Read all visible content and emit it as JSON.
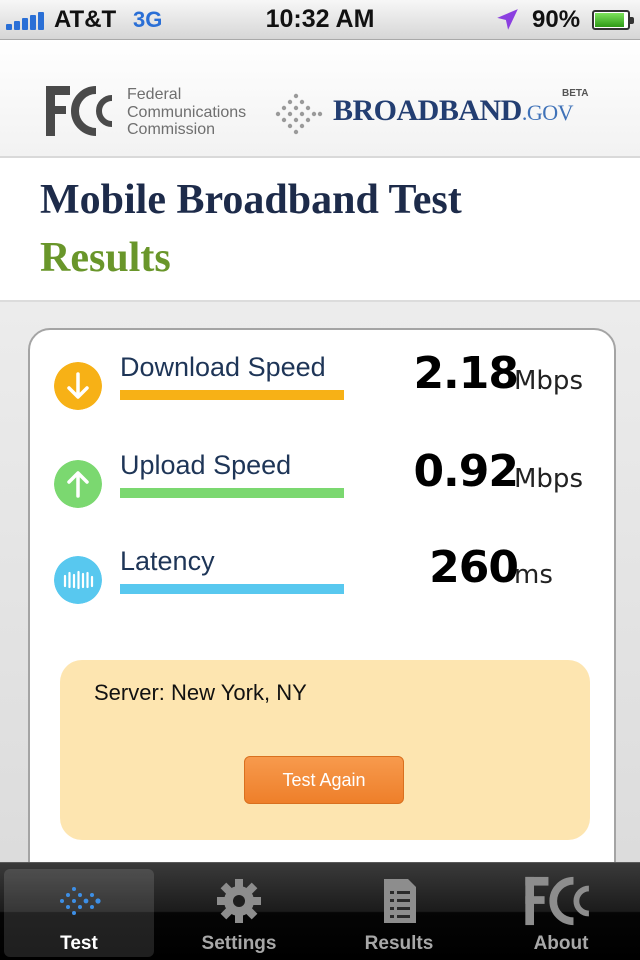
{
  "status_bar": {
    "carrier": "AT&T",
    "network": "3G",
    "time": "10:32 AM",
    "battery": "90%",
    "battery_level": 0.9,
    "icons": [
      "signal-icon",
      "location-arrow-icon",
      "battery-icon"
    ]
  },
  "header": {
    "fcc_name_lines": [
      "Federal",
      "Communications",
      "Commission"
    ],
    "broadband_word": "BROADBAND",
    "broadband_suffix": ".GOV",
    "broadband_badge": "BETA"
  },
  "title": {
    "main": "Mobile Broadband Test",
    "sub": "Results"
  },
  "metrics": [
    {
      "label": "Download Speed",
      "value": "2.18",
      "unit": "Mbps",
      "color": "#f7b116",
      "icon": "download-arrow-icon"
    },
    {
      "label": "Upload Speed",
      "value": "0.92",
      "unit": "Mbps",
      "color": "#7bd870",
      "icon": "upload-arrow-icon"
    },
    {
      "label": "Latency",
      "value": "260",
      "unit": "ms",
      "color": "#58c8ef",
      "icon": "latency-bars-icon"
    }
  ],
  "server": {
    "text": "Server: New York, NY",
    "button": "Test Again"
  },
  "tabs": [
    {
      "label": "Test",
      "icon": "test-arrow-icon",
      "active": true
    },
    {
      "label": "Settings",
      "icon": "gear-icon",
      "active": false
    },
    {
      "label": "Results",
      "icon": "document-icon",
      "active": false
    },
    {
      "label": "About",
      "icon": "fcc-icon",
      "active": false
    }
  ],
  "colors": {
    "title_navy": "#1d2b4a",
    "title_green": "#69962a",
    "server_box": "#fde5b0",
    "button": "#f08a36"
  }
}
